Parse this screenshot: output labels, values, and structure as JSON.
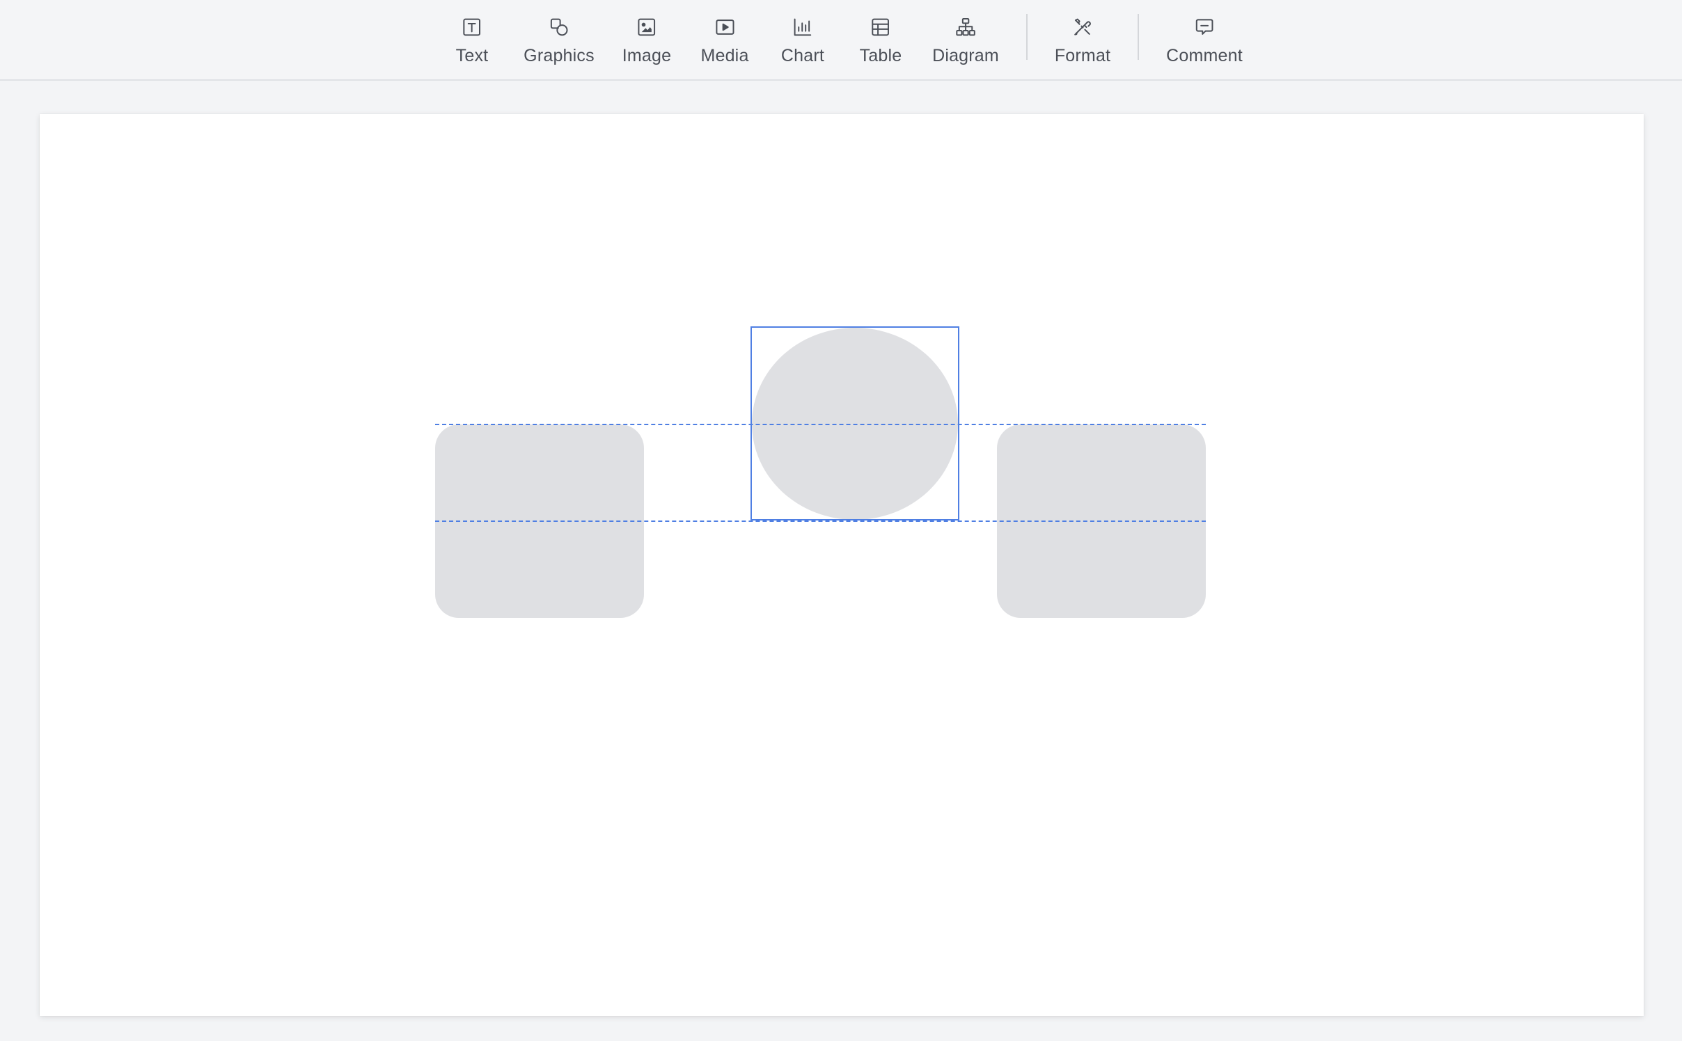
{
  "toolbar": {
    "items": [
      {
        "label": "Text",
        "icon": "text-box-icon"
      },
      {
        "label": "Graphics",
        "icon": "shapes-icon"
      },
      {
        "label": "Image",
        "icon": "image-icon"
      },
      {
        "label": "Media",
        "icon": "play-icon"
      },
      {
        "label": "Chart",
        "icon": "bar-chart-icon"
      },
      {
        "label": "Table",
        "icon": "table-icon"
      },
      {
        "label": "Diagram",
        "icon": "hierarchy-icon"
      },
      {
        "label": "Format",
        "icon": "format-tools-icon"
      },
      {
        "label": "Comment",
        "icon": "comment-icon"
      }
    ]
  },
  "slide": {
    "shapes": [
      {
        "kind": "rounded-rectangle",
        "fill": "#dfe0e3"
      },
      {
        "kind": "ellipse",
        "fill": "#dfe0e3",
        "selected": true
      },
      {
        "kind": "rounded-rectangle",
        "fill": "#dfe0e3"
      }
    ],
    "alignment_guides": 2
  },
  "colors": {
    "accent": "#4f7fe3",
    "shape_fill": "#dfe0e3",
    "toolbar_bg": "#f4f5f7",
    "canvas_bg": "#f3f4f6",
    "icon": "#4b4f57"
  }
}
